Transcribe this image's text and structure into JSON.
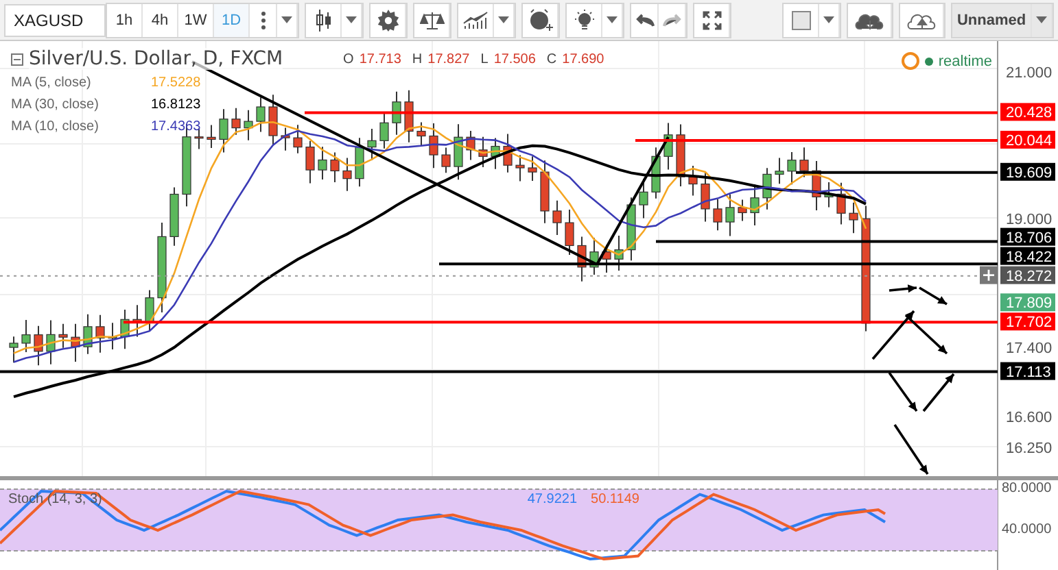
{
  "toolbar": {
    "symbol": "XAGUSD",
    "intervals": [
      {
        "label": "1h",
        "selected": false
      },
      {
        "label": "4h",
        "selected": false
      },
      {
        "label": "1W",
        "selected": false
      },
      {
        "label": "1D",
        "selected": true
      }
    ],
    "chart_name": "Unnamed"
  },
  "legend": {
    "title": "Silver/U.S. Dollar, D, FXCM",
    "ohlc": [
      {
        "key": "O",
        "value": "17.713"
      },
      {
        "key": "H",
        "value": "17.827"
      },
      {
        "key": "L",
        "value": "17.506"
      },
      {
        "key": "C",
        "value": "17.690"
      }
    ],
    "indicators": [
      {
        "name": "MA (5, close)",
        "value": "17.5228",
        "color": "#f5a623"
      },
      {
        "name": "MA (30, close)",
        "value": "16.8123",
        "color": "#000000"
      },
      {
        "name": "MA (10, close)",
        "value": "17.4363",
        "color": "#3b3bb5"
      }
    ],
    "status": "realtime"
  },
  "price_axis": [
    "21.000",
    "19.000",
    "17.400",
    "16.600",
    "16.250"
  ],
  "price_labels": [
    {
      "label": "20.428",
      "color": "#ff0000",
      "kind": "line"
    },
    {
      "label": "20.044",
      "color": "#ff0000",
      "kind": "line"
    },
    {
      "label": "19.609",
      "color": "#000000",
      "kind": "line"
    },
    {
      "label": "18.706",
      "color": "#000000",
      "kind": "line"
    },
    {
      "label": "18.422",
      "color": "#000000",
      "kind": "line"
    },
    {
      "label": "18.272",
      "color": "#555555",
      "kind": "crosshair"
    },
    {
      "label": "17.809",
      "color": "#4caf7a",
      "kind": "price"
    },
    {
      "label": "17.702",
      "color": "#ff0000",
      "kind": "line"
    },
    {
      "label": "17.113",
      "color": "#000000",
      "kind": "line"
    }
  ],
  "oscillator": {
    "name": "Stoch (14, 3, 3)",
    "values": [
      {
        "value": "47.9221",
        "color": "#2e7ef0"
      },
      {
        "value": "50.1149",
        "color": "#f0602a"
      }
    ],
    "axis": [
      "80.0000",
      "40.0000"
    ]
  }
}
